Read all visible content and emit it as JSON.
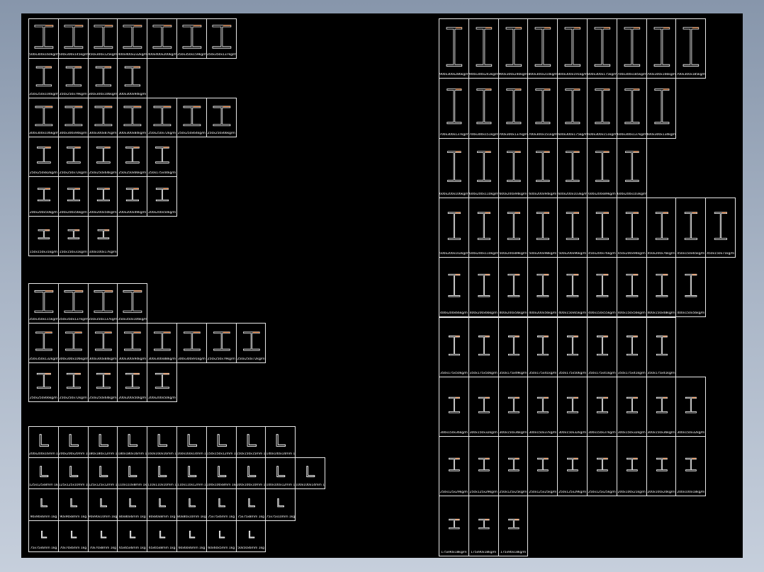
{
  "colors": {
    "background": "#000000",
    "line": "#ffffff",
    "accent": "#f07a2a",
    "frame": "#e8e8e8"
  },
  "groups": [
    {
      "name": "hw-wide-flange",
      "rows": [
        {
          "shape": "I",
          "scale": 1.0,
          "flange": 1.0,
          "labels": [
            "500x300x160kg/m",
            "500x300x145kg/m",
            "450x300x125kg/m",
            "400x400x232kg/m",
            "400x400x200kg/m",
            "350x350x159kg/m",
            "350x350x137kg/m"
          ]
        },
        {
          "shape": "I",
          "scale": 0.85,
          "flange": 0.7,
          "labels": [
            "350x250x104kg/m",
            "350x250x79kg/m",
            "300x300x106kg/m",
            "300x300x94kg/m"
          ]
        },
        {
          "shape": "I",
          "scale": 0.85,
          "flange": 0.85,
          "labels": [
            "300x300x106kg/m",
            "300x300x94kg/m",
            "300x300x87kg/m",
            "300x300x84kg/m",
            "250x250x72kg/m",
            "250x250x64kg/m",
            "250x250x66kg/m"
          ]
        },
        {
          "shape": "I",
          "scale": 0.7,
          "flange": 0.6,
          "labels": [
            "250x250x82kg/m",
            "250x250x72kg/m",
            "250x250x64kg/m",
            "250x250x66kg/m",
            "250x175x44kg/m"
          ]
        },
        {
          "shape": "I",
          "scale": 0.55,
          "flange": 0.55,
          "labels": [
            "200x200x50kg/m",
            "200x200x56kg/m",
            "200x200x50kg/m",
            "200x200x49kg/m",
            "200x200x50kg/m"
          ]
        },
        {
          "shape": "I",
          "scale": 0.4,
          "flange": 0.5,
          "labels": [
            "150x150x31kg/m",
            "150x150x31kg/m",
            "100x100x17kg/m"
          ]
        }
      ]
    },
    {
      "name": "hm-medium-flange",
      "rows": [
        {
          "shape": "I",
          "scale": 0.95,
          "flange": 0.95,
          "labels": [
            "350x350x115kg/m",
            "350x350x137kg/m",
            "350x350x137kg/m",
            "350x350x106kg/m"
          ]
        },
        {
          "shape": "I",
          "scale": 0.8,
          "flange": 0.8,
          "labels": [
            "350x350x132kg/m",
            "300x300x106kg/m",
            "300x300x84kg/m",
            "300x300x94kg/m",
            "300x300x88kg/m",
            "300x300x91kg/m",
            "250x250x79kg/m",
            "250x250x72kg/m"
          ]
        },
        {
          "shape": "I",
          "scale": 0.65,
          "flange": 0.65,
          "labels": [
            "250x250x66kg/m",
            "250x250x72kg/m",
            "250x250x64kg/m",
            "200x200x50kg/m",
            "200x200x50kg/m"
          ]
        }
      ]
    },
    {
      "name": "angle-steel",
      "rows": [
        {
          "shape": "L",
          "scale": 1.0,
          "labels": [
            "200x200x16mm 1kg",
            "200x200x20mm 1kg",
            "180x180x12mm 1kg",
            "180x180x16mm 1kg",
            "160x160x16mm 1kg",
            "160x160x14mm 1kg",
            "150x150x12mm 1kg",
            "150x150x15mm 1kg",
            "140x140x14mm 1kg"
          ]
        },
        {
          "shape": "L",
          "scale": 0.85,
          "labels": [
            "125x125x8mm 1kg",
            "125x125x10mm 1kg",
            "125x125x12mm 1kg",
            "110x110x8mm 1kg",
            "110x110x10mm 1kg",
            "110x110x12mm 1kg",
            "100x100x8mm 1kg",
            "100x100x10mm 1kg",
            "100x100x12mm 1kg",
            "100x100x14mm 1kg"
          ]
        },
        {
          "shape": "L",
          "scale": 0.6,
          "labels": [
            "90x90x6mm 1kg",
            "90x90x8mm 1kg",
            "90x90x10mm 1kg",
            "80x80x6mm 1kg",
            "80x80x8mm 1kg",
            "80x80x10mm 1kg",
            "75x75x6mm 1kg",
            "75x75x8mm 1kg",
            "75x75x10mm 1kg"
          ]
        },
        {
          "shape": "L",
          "scale": 0.45,
          "labels": [
            "75x75x6mm 1kg",
            "70x70x6mm 1kg",
            "70x70x8mm 1kg",
            "65x65x6mm 1kg",
            "65x65x8mm 1kg",
            "60x60x6mm 1kg",
            "60x60x5mm 1kg",
            "50x50x6mm 1kg"
          ]
        }
      ]
    },
    {
      "name": "hn-narrow-flange",
      "rows": [
        {
          "shape": "I",
          "scale": 1.0,
          "flange": 0.65,
          "labels": [
            "900x300x286kg/m",
            "900x300x243kg/m",
            "900x300x240kg/m",
            "800x300x210kg/m",
            "800x300x191kg/m",
            "800x300x175kg/m",
            "700x300x185kg/m",
            "700x300x166kg/m",
            "700x300x185kg/m"
          ]
        },
        {
          "shape": "I",
          "scale": 0.9,
          "flange": 0.6,
          "labels": [
            "700x300x137kg/m",
            "700x300x151kg/m",
            "700x300x137kg/m",
            "700x300x151kg/m",
            "600x300x175kg/m",
            "600x300x151kg/m",
            "600x300x137kg/m",
            "600x300x134kg/m"
          ]
        },
        {
          "shape": "I",
          "scale": 0.78,
          "flange": 0.55,
          "labels": [
            "600x200x106kg/m",
            "600x200x110kg/m",
            "600x200x94kg/m",
            "600x200x94kg/m",
            "600x200x103kg/m",
            "600x200x89kg/m",
            "600x200x103kg/m"
          ]
        },
        {
          "shape": "I",
          "scale": 0.7,
          "flange": 0.5,
          "labels": [
            "500x200x102kg/m",
            "500x200x110kg/m",
            "500x200x89kg/m",
            "500x200x98kg/m",
            "500x200x96kg/m",
            "450x200x76kg/m",
            "450x200x94kg/m",
            "450x200x76kg/m",
            "450x150x65kg/m",
            "450x150x71kg/m"
          ]
        },
        {
          "shape": "I",
          "scale": 0.58,
          "flange": 0.45,
          "labels": [
            "400x200x66kg/m",
            "400x200x66kg/m",
            "400x200x56kg/m",
            "400x200x56kg/m",
            "400x150x65kg/m",
            "400x150x55kg/m",
            "400x150x56kg/m",
            "400x150x48kg/m",
            "400x150x56kg/m"
          ]
        },
        {
          "shape": "I",
          "scale": 0.5,
          "flange": 0.4,
          "labels": [
            "350x175x50kg/m",
            "350x175x50kg/m",
            "350x175x49kg/m",
            "350x175x41kg/m",
            "350x175x50kg/m",
            "350x175x41kg/m",
            "350x175x41kg/m",
            "350x175x41kg/m"
          ]
        },
        {
          "shape": "I",
          "scale": 0.4,
          "flange": 0.45,
          "labels": [
            "300x150x36kg/m",
            "300x150x32kg/m",
            "300x150x36kg/m",
            "300x150x37kg/m",
            "300x150x32kg/m",
            "300x150x37kg/m",
            "300x150x32kg/m",
            "300x150x36kg/m",
            "300x150x32kg/m"
          ]
        },
        {
          "shape": "I",
          "scale": 0.33,
          "flange": 0.45,
          "labels": [
            "250x125x29kg/m",
            "250x125x29kg/m",
            "250x125x25kg/m",
            "250x125x25kg/m",
            "250x125x29kg/m",
            "250x125x25kg/m",
            "200x100x21kg/m",
            "200x100x20kg/m",
            "200x100x18kg/m"
          ]
        },
        {
          "shape": "I",
          "scale": 0.25,
          "flange": 0.45,
          "labels": [
            "175x90x18kg/m",
            "175x90x18kg/m",
            "175x90x18kg/m"
          ]
        }
      ]
    }
  ]
}
